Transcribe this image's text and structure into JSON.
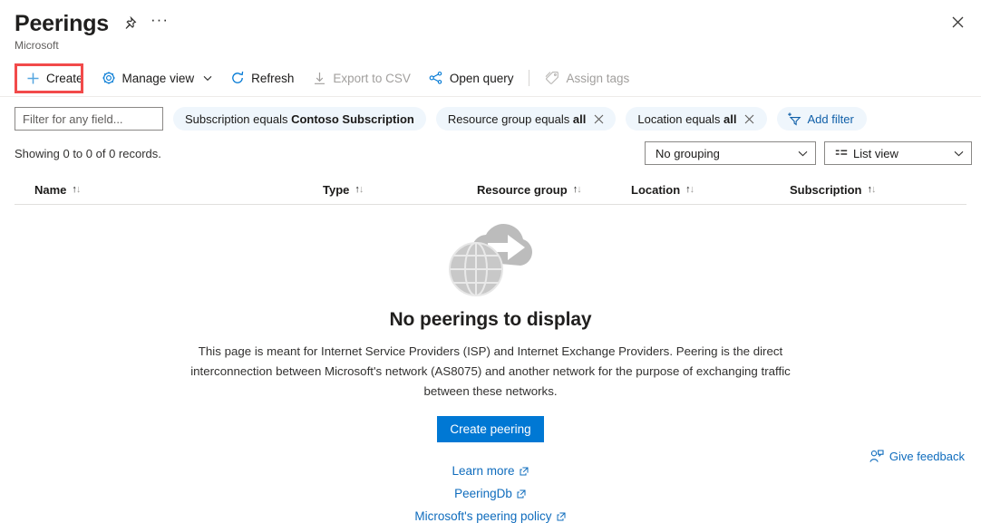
{
  "header": {
    "title": "Peerings",
    "subtitle": "Microsoft",
    "pin_icon": "pin-icon",
    "more_icon": "ellipsis-icon",
    "close_icon": "close-icon"
  },
  "toolbar": {
    "items": [
      {
        "label": "Create",
        "icon": "plus-icon",
        "disabled": false,
        "chevron": false,
        "highlighted": true
      },
      {
        "label": "Manage view",
        "icon": "gear-icon",
        "disabled": false,
        "chevron": true,
        "highlighted": false
      },
      {
        "label": "Refresh",
        "icon": "refresh-icon",
        "disabled": false,
        "chevron": false,
        "highlighted": false
      },
      {
        "label": "Export to CSV",
        "icon": "download-icon",
        "disabled": true,
        "chevron": false,
        "highlighted": false
      },
      {
        "label": "Open query",
        "icon": "share-graph-icon",
        "disabled": false,
        "chevron": false,
        "highlighted": false
      },
      {
        "label": "Assign tags",
        "icon": "tag-icon",
        "disabled": true,
        "chevron": false,
        "highlighted": false
      }
    ],
    "highlight_color": "#f24a4a"
  },
  "filters": {
    "search_placeholder": "Filter for any field...",
    "search_value": "",
    "pills": [
      {
        "prefix": "Subscription equals ",
        "value": "Contoso Subscription",
        "removable": false
      },
      {
        "prefix": "Resource group equals ",
        "value": "all",
        "removable": true
      },
      {
        "prefix": "Location equals ",
        "value": "all",
        "removable": true
      }
    ],
    "add_filter_label": "Add filter"
  },
  "results": {
    "showing": "Showing 0 to 0 of 0 records.",
    "grouping": "No grouping",
    "view": "List view"
  },
  "table": {
    "columns": [
      {
        "label": "Name"
      },
      {
        "label": "Type"
      },
      {
        "label": "Resource group"
      },
      {
        "label": "Location"
      },
      {
        "label": "Subscription"
      }
    ],
    "rows": []
  },
  "empty_state": {
    "illustration": "globe-cloud-peering-icon",
    "title": "No peerings to display",
    "description": "This page is meant for Internet Service Providers (ISP) and Internet Exchange Providers. Peering is the direct interconnection between Microsoft's network (AS8075) and another network for the purpose of exchanging traffic between these networks.",
    "primary_button": "Create peering",
    "links": [
      {
        "label": "Learn more"
      },
      {
        "label": "PeeringDb"
      },
      {
        "label": "Microsoft's peering policy"
      }
    ]
  },
  "feedback": {
    "label": "Give feedback",
    "icon": "person-feedback-icon"
  },
  "colors": {
    "accent": "#0078d4",
    "link": "#0f6cbd",
    "pill_bg": "#eff6fc",
    "highlight": "#f24a4a"
  }
}
